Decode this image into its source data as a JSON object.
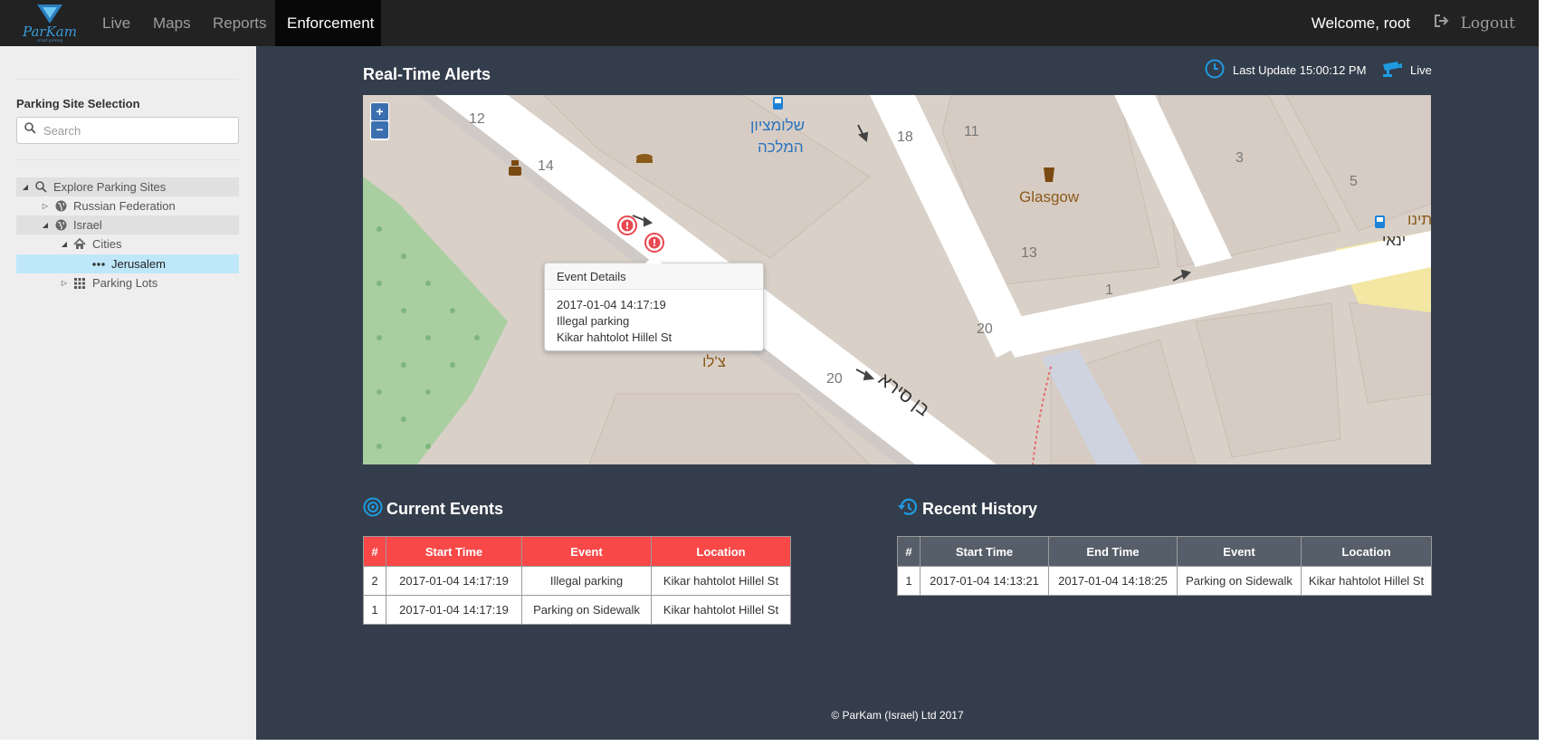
{
  "nav": {
    "items": [
      {
        "label": "Live"
      },
      {
        "label": "Maps"
      },
      {
        "label": "Reports"
      },
      {
        "label": "Enforcement"
      }
    ],
    "welcome": "Welcome, root",
    "logout_label": "Logout"
  },
  "sidebar": {
    "title": "Parking Site Selection",
    "search_placeholder": "Search",
    "tree": [
      {
        "label": "Explore Parking Sites",
        "icon": "search-icon",
        "expanded": true
      },
      {
        "label": "Russian Federation",
        "icon": "globe-icon",
        "expanded": false
      },
      {
        "label": "Israel",
        "icon": "globe-icon",
        "expanded": true
      },
      {
        "label": "Cities",
        "icon": "home-icon",
        "expanded": true
      },
      {
        "label": "Jerusalem",
        "icon": "ellipsis-icon",
        "selected": true
      },
      {
        "label": "Parking Lots",
        "icon": "grid-icon",
        "expanded": false
      }
    ]
  },
  "alerts": {
    "title": "Real-Time Alerts",
    "last_update": "Last Update 15:00:12 PM",
    "live_label": "Live"
  },
  "map": {
    "zoom_in": "+",
    "zoom_out": "−",
    "labels": {
      "n12": "12",
      "n14": "14",
      "n18": "18",
      "n11": "11",
      "n3": "3",
      "n5": "5",
      "n13": "13",
      "n1": "1",
      "n20a": "20",
      "n20b": "20",
      "bus_stop": "שלומציון",
      "bus_stop2": "המלכה",
      "glasgow": "Glasgow",
      "yanai": "ינאי",
      "yanai2": "ינאי",
      "ben_sira": "בן סירא",
      "tzilo": "צ'לו",
      "edge_text": "תינו"
    },
    "popup": {
      "title": "Event Details",
      "time": "2017-01-04 14:17:19",
      "event": "Illegal parking",
      "location": "Kikar hahtolot Hillel St"
    }
  },
  "current_events": {
    "title": "Current Events",
    "columns": [
      "#",
      "Start Time",
      "Event",
      "Location"
    ],
    "rows": [
      [
        "2",
        "2017-01-04 14:17:19",
        "Illegal parking",
        "Kikar hahtolot Hillel St"
      ],
      [
        "1",
        "2017-01-04 14:17:19",
        "Parking on Sidewalk",
        "Kikar hahtolot Hillel St"
      ]
    ]
  },
  "recent_history": {
    "title": "Recent History",
    "columns": [
      "#",
      "Start Time",
      "End Time",
      "Event",
      "Location"
    ],
    "rows": [
      [
        "1",
        "2017-01-04 14:13:21",
        "2017-01-04 14:18:25",
        "Parking on Sidewalk",
        "Kikar hahtolot Hillel St"
      ]
    ]
  },
  "footer": "© ParKam (Israel) Ltd 2017",
  "colors": {
    "topbar": "#222222",
    "main_bg": "#343d4b",
    "sidebar_bg": "#eeeeee",
    "current_header": "#f84848",
    "history_header": "#555e69",
    "accent": "#1e9be0",
    "alert_marker": "#e8484f"
  }
}
